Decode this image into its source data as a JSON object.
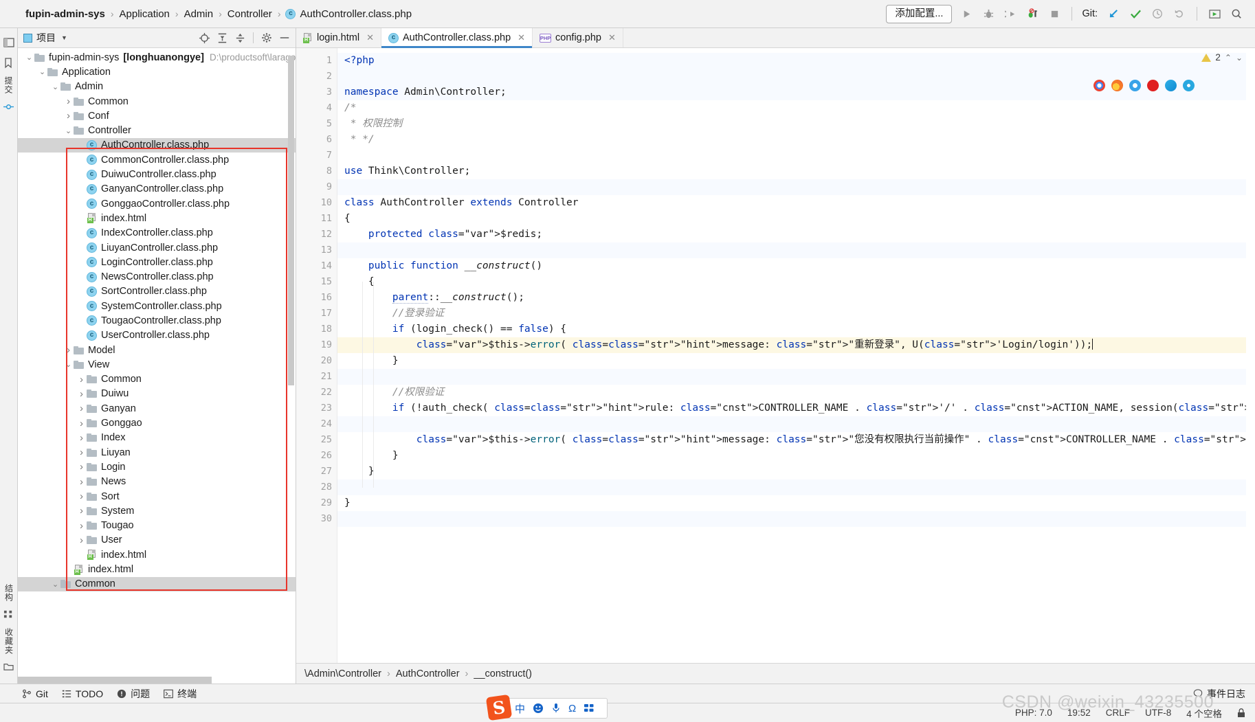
{
  "topbar": {
    "breadcrumb": [
      {
        "label": "fupin-admin-sys",
        "bold": true
      },
      {
        "label": "Application",
        "bold": false
      },
      {
        "label": "Admin",
        "bold": false
      },
      {
        "label": "Controller",
        "bold": false
      }
    ],
    "separator": "›",
    "current_file": "AuthController.class.php",
    "add_config_label": "添加配置...",
    "git_label": "Git:",
    "icons": [
      "run-icon",
      "debug-icon",
      "run-with-coverage-icon",
      "profile-icon",
      "stop-icon",
      "git-update-icon",
      "git-commit-icon",
      "git-history-icon",
      "git-rollback-icon",
      "run-anything-icon",
      "search-everywhere-icon"
    ]
  },
  "left_rail": {
    "top_label": "提交",
    "bottom_labels": [
      "结构",
      "收藏夹"
    ]
  },
  "project_panel": {
    "title": "项目",
    "actions": [
      "locate-icon",
      "expand-all-icon",
      "collapse-all-icon",
      "settings-icon",
      "hide-icon"
    ],
    "tree": [
      {
        "depth": 0,
        "arrow": "down",
        "icon": "folder",
        "label": "fupin-admin-sys",
        "bracket": "[longhuanongye]",
        "path": "D:\\productsoft\\larago",
        "selected": false
      },
      {
        "depth": 1,
        "arrow": "down",
        "icon": "folder",
        "label": "Application",
        "selected": false
      },
      {
        "depth": 2,
        "arrow": "down",
        "icon": "folder",
        "label": "Admin",
        "selected": false
      },
      {
        "depth": 3,
        "arrow": "right",
        "icon": "folder",
        "label": "Common",
        "selected": false
      },
      {
        "depth": 3,
        "arrow": "right",
        "icon": "folder",
        "label": "Conf",
        "selected": false
      },
      {
        "depth": 3,
        "arrow": "down",
        "icon": "folder",
        "label": "Controller",
        "selected": false
      },
      {
        "depth": 4,
        "arrow": "none",
        "icon": "class",
        "label": "AuthController.class.php",
        "selected": true
      },
      {
        "depth": 4,
        "arrow": "none",
        "icon": "class",
        "label": "CommonController.class.php",
        "selected": false
      },
      {
        "depth": 4,
        "arrow": "none",
        "icon": "class",
        "label": "DuiwuController.class.php",
        "selected": false
      },
      {
        "depth": 4,
        "arrow": "none",
        "icon": "class",
        "label": "GanyanController.class.php",
        "selected": false
      },
      {
        "depth": 4,
        "arrow": "none",
        "icon": "class",
        "label": "GonggaoController.class.php",
        "selected": false
      },
      {
        "depth": 4,
        "arrow": "none",
        "icon": "html",
        "label": "index.html",
        "selected": false
      },
      {
        "depth": 4,
        "arrow": "none",
        "icon": "class",
        "label": "IndexController.class.php",
        "selected": false
      },
      {
        "depth": 4,
        "arrow": "none",
        "icon": "class",
        "label": "LiuyanController.class.php",
        "selected": false
      },
      {
        "depth": 4,
        "arrow": "none",
        "icon": "class",
        "label": "LoginController.class.php",
        "selected": false
      },
      {
        "depth": 4,
        "arrow": "none",
        "icon": "class",
        "label": "NewsController.class.php",
        "selected": false
      },
      {
        "depth": 4,
        "arrow": "none",
        "icon": "class",
        "label": "SortController.class.php",
        "selected": false
      },
      {
        "depth": 4,
        "arrow": "none",
        "icon": "class",
        "label": "SystemController.class.php",
        "selected": false
      },
      {
        "depth": 4,
        "arrow": "none",
        "icon": "class",
        "label": "TougaoController.class.php",
        "selected": false
      },
      {
        "depth": 4,
        "arrow": "none",
        "icon": "class",
        "label": "UserController.class.php",
        "selected": false
      },
      {
        "depth": 3,
        "arrow": "right",
        "icon": "folder",
        "label": "Model",
        "selected": false
      },
      {
        "depth": 3,
        "arrow": "down",
        "icon": "folder",
        "label": "View",
        "selected": false
      },
      {
        "depth": 4,
        "arrow": "right",
        "icon": "folder",
        "label": "Common",
        "selected": false
      },
      {
        "depth": 4,
        "arrow": "right",
        "icon": "folder",
        "label": "Duiwu",
        "selected": false
      },
      {
        "depth": 4,
        "arrow": "right",
        "icon": "folder",
        "label": "Ganyan",
        "selected": false
      },
      {
        "depth": 4,
        "arrow": "right",
        "icon": "folder",
        "label": "Gonggao",
        "selected": false
      },
      {
        "depth": 4,
        "arrow": "right",
        "icon": "folder",
        "label": "Index",
        "selected": false
      },
      {
        "depth": 4,
        "arrow": "right",
        "icon": "folder",
        "label": "Liuyan",
        "selected": false
      },
      {
        "depth": 4,
        "arrow": "right",
        "icon": "folder",
        "label": "Login",
        "selected": false
      },
      {
        "depth": 4,
        "arrow": "right",
        "icon": "folder",
        "label": "News",
        "selected": false
      },
      {
        "depth": 4,
        "arrow": "right",
        "icon": "folder",
        "label": "Sort",
        "selected": false
      },
      {
        "depth": 4,
        "arrow": "right",
        "icon": "folder",
        "label": "System",
        "selected": false
      },
      {
        "depth": 4,
        "arrow": "right",
        "icon": "folder",
        "label": "Tougao",
        "selected": false
      },
      {
        "depth": 4,
        "arrow": "right",
        "icon": "folder",
        "label": "User",
        "selected": false
      },
      {
        "depth": 4,
        "arrow": "none",
        "icon": "html",
        "label": "index.html",
        "selected": false
      },
      {
        "depth": 3,
        "arrow": "none",
        "icon": "html",
        "label": "index.html",
        "selected": false
      },
      {
        "depth": 2,
        "arrow": "down",
        "icon": "folder",
        "label": "Common",
        "selected": false
      }
    ]
  },
  "editor": {
    "tabs": [
      {
        "label": "login.html",
        "icon": "html-file-icon",
        "active": false
      },
      {
        "label": "AuthController.class.php",
        "icon": "php-class-icon",
        "active": true
      },
      {
        "label": "config.php",
        "icon": "php-file-icon",
        "active": false
      }
    ],
    "warning_count": "2",
    "lines": [
      {
        "n": "1",
        "text": "<?php"
      },
      {
        "n": "2",
        "text": ""
      },
      {
        "n": "3",
        "text": "namespace Admin\\Controller;"
      },
      {
        "n": "4",
        "text": "/*"
      },
      {
        "n": "5",
        "text": " * 权限控制"
      },
      {
        "n": "6",
        "text": " * */"
      },
      {
        "n": "7",
        "text": ""
      },
      {
        "n": "8",
        "text": "use Think\\Controller;"
      },
      {
        "n": "9",
        "text": ""
      },
      {
        "n": "10",
        "text": "class AuthController extends Controller"
      },
      {
        "n": "11",
        "text": "{"
      },
      {
        "n": "12",
        "text": "    protected $redis;"
      },
      {
        "n": "13",
        "text": ""
      },
      {
        "n": "14",
        "text": "    public function __construct()"
      },
      {
        "n": "15",
        "text": "    {"
      },
      {
        "n": "16",
        "text": "        parent::__construct();"
      },
      {
        "n": "17",
        "text": "        //登录验证"
      },
      {
        "n": "18",
        "text": "        if (login_check() == false) {"
      },
      {
        "n": "19",
        "text": "            $this->error( message: \"重新登录\", U('Login/login'));"
      },
      {
        "n": "20",
        "text": "        }"
      },
      {
        "n": "21",
        "text": ""
      },
      {
        "n": "22",
        "text": "        //权限验证"
      },
      {
        "n": "23",
        "text": "        if (!auth_check( rule: CONTROLLER_NAME . '/' . ACTION_NAME, session(\"admin.id\"))) {"
      },
      {
        "n": "24",
        "text": ""
      },
      {
        "n": "25",
        "text": "            $this->error( message: \"您没有权限执行当前操作\" . CONTROLLER_NAME . '/' . ACTION_NAME);"
      },
      {
        "n": "26",
        "text": "        }"
      },
      {
        "n": "27",
        "text": "    }"
      },
      {
        "n": "28",
        "text": ""
      },
      {
        "n": "29",
        "text": "}"
      },
      {
        "n": "30",
        "text": ""
      }
    ],
    "param_hints": {
      "message": "message:",
      "rule": "rule:"
    },
    "breadcrumb": [
      "\\Admin\\Controller",
      "AuthController",
      "__construct()"
    ],
    "breadcrumb_sep": "›"
  },
  "bottom_toolbar": {
    "items": [
      {
        "label": "Git",
        "icon": "git-branch-icon"
      },
      {
        "label": "TODO",
        "icon": "todo-list-icon"
      },
      {
        "label": "问题",
        "icon": "problems-icon"
      },
      {
        "label": "终端",
        "icon": "terminal-icon"
      }
    ],
    "event_log": {
      "label": "事件日志",
      "icon": "balloon-icon"
    }
  },
  "statusbar": {
    "php_version": "PHP: 7.0",
    "caret": "19:52",
    "line_sep": "CRLF",
    "encoding": "UTF-8",
    "indent": "4 个空格",
    "lock_icon": "lock-icon"
  },
  "ime_bar": {
    "logo": "S",
    "items": [
      "中",
      "emoji-icon",
      "mic-icon",
      "Ω",
      "apps-icon"
    ]
  },
  "watermark": "CSDN @weixin_43235500",
  "colors": {
    "accent": "#3e86c9",
    "annotation_red": "#e8342a",
    "string_green": "#067d17",
    "keyword_blue": "#0033b3",
    "constant_purple": "#871094",
    "selection_gray": "#d4d4d4",
    "current_line": "#fdf8e3"
  }
}
